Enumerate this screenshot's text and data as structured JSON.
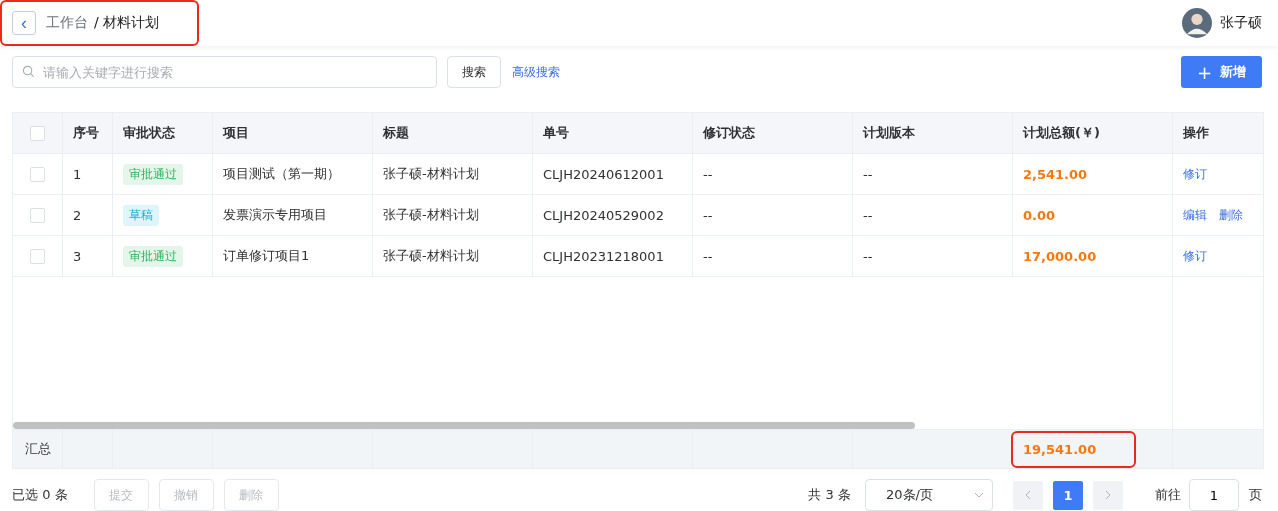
{
  "header": {
    "back_icon": "‹",
    "breadcrumb": [
      {
        "label": "工作台",
        "current": false
      },
      {
        "label": "/ 材料计划",
        "current": true
      }
    ],
    "user": {
      "name": "张子硕"
    }
  },
  "search": {
    "placeholder": "请输入关键字进行搜索",
    "button": "搜索",
    "advanced_link": "高级搜索"
  },
  "add_button": {
    "icon": "+",
    "label": "新增"
  },
  "table": {
    "all_selected": false,
    "columns": [
      "序号",
      "审批状态",
      "项目",
      "标题",
      "单号",
      "修订状态",
      "计划版本",
      "计划总额(￥)",
      "操作"
    ],
    "rows": [
      {
        "selected": false,
        "index": "1",
        "status": {
          "label": "审批通过",
          "kind": "approved"
        },
        "project": "项目测试（第一期）",
        "title": "张子硕-材料计划",
        "number": "CLJH20240612001",
        "revision": "--",
        "version": "--",
        "total": "2,541.00",
        "actions": [
          "修订"
        ]
      },
      {
        "selected": false,
        "index": "2",
        "status": {
          "label": "草稿",
          "kind": "draft"
        },
        "project": "发票演示专用项目",
        "title": "张子硕-材料计划",
        "number": "CLJH20240529002",
        "revision": "--",
        "version": "--",
        "total": "0.00",
        "actions": [
          "编辑",
          "删除"
        ]
      },
      {
        "selected": false,
        "index": "3",
        "status": {
          "label": "审批通过",
          "kind": "approved"
        },
        "project": "订单修订项目1",
        "title": "张子硕-材料计划",
        "number": "CLJH20231218001",
        "revision": "--",
        "version": "--",
        "total": "17,000.00",
        "actions": [
          "修订"
        ]
      }
    ],
    "summary": {
      "label": "汇总",
      "total": "19,541.00",
      "highlighted": true
    }
  },
  "footer": {
    "selected_count": "已选 0 条",
    "buttons": [
      {
        "label": "提交",
        "disabled": true
      },
      {
        "label": "撤销",
        "disabled": true
      },
      {
        "label": "删除",
        "disabled": true
      }
    ],
    "total": "共 3 条",
    "page_size": "20条/页",
    "pages": [
      {
        "label": "1",
        "selected": true
      }
    ],
    "goto_label": "前往",
    "goto_value": "1",
    "page_unit": "页"
  }
}
